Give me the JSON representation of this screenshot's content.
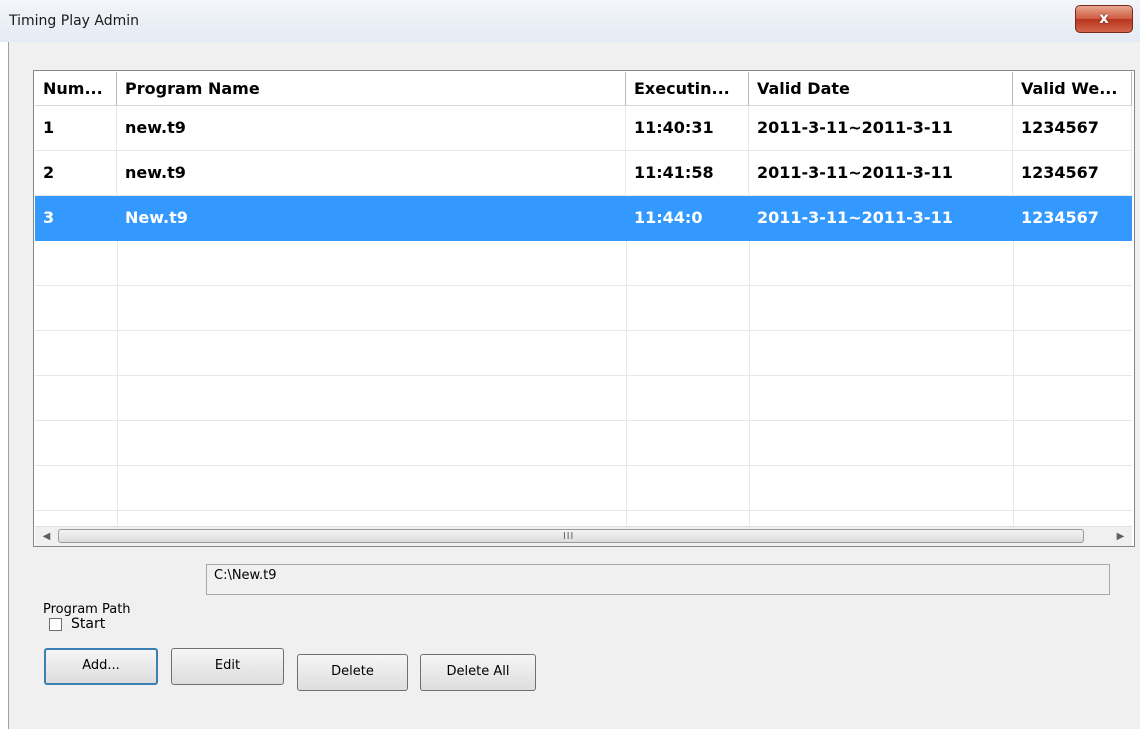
{
  "window": {
    "title": "Timing Play Admin",
    "close_glyph": "x"
  },
  "table": {
    "headers": [
      "Num...",
      "Program Name",
      "Executin...",
      "Valid Date",
      "Valid We..."
    ],
    "rows": [
      {
        "num": "1",
        "name": "new.t9",
        "time": "11:40:31",
        "date": "2011-3-11~2011-3-11",
        "week": "1234567"
      },
      {
        "num": "2",
        "name": "new.t9",
        "time": "11:41:58",
        "date": "2011-3-11~2011-3-11",
        "week": "1234567"
      },
      {
        "num": "3",
        "name": "New.t9",
        "time": "11:44:0",
        "date": "2011-3-11~2011-3-11",
        "week": "1234567",
        "selected": true
      }
    ],
    "selection_color": "#3399ff"
  },
  "scrollbar": {
    "left_arrow": "◀",
    "right_arrow": "▶",
    "grip": "III"
  },
  "program_path": {
    "label": "Program Path",
    "value": "C:\\New.t9"
  },
  "start_checkbox": {
    "label": "Start",
    "checked": false
  },
  "buttons": {
    "add": "Add...",
    "edit": "Edit",
    "delete": "Delete",
    "delete_all": "Delete All"
  }
}
